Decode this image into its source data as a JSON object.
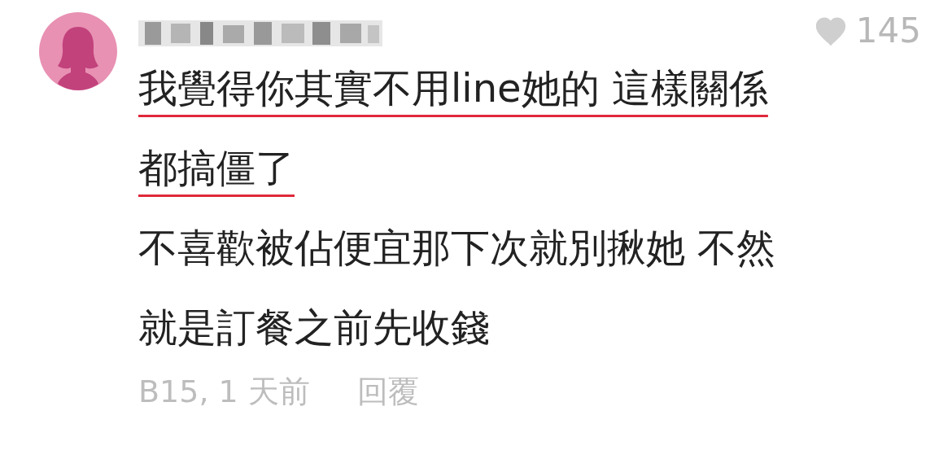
{
  "comment": {
    "likes": "145",
    "paragraphs": [
      {
        "lines": [
          "我覺得你其實不用line她的 這樣關係",
          "都搞僵了"
        ],
        "highlighted": true
      },
      {
        "lines": [
          "不喜歡被佔便宜那下次就別揪她 不然",
          "就是訂餐之前先收錢"
        ],
        "highlighted": false
      }
    ],
    "floor": "B15, 1 天前",
    "reply": "回覆"
  }
}
